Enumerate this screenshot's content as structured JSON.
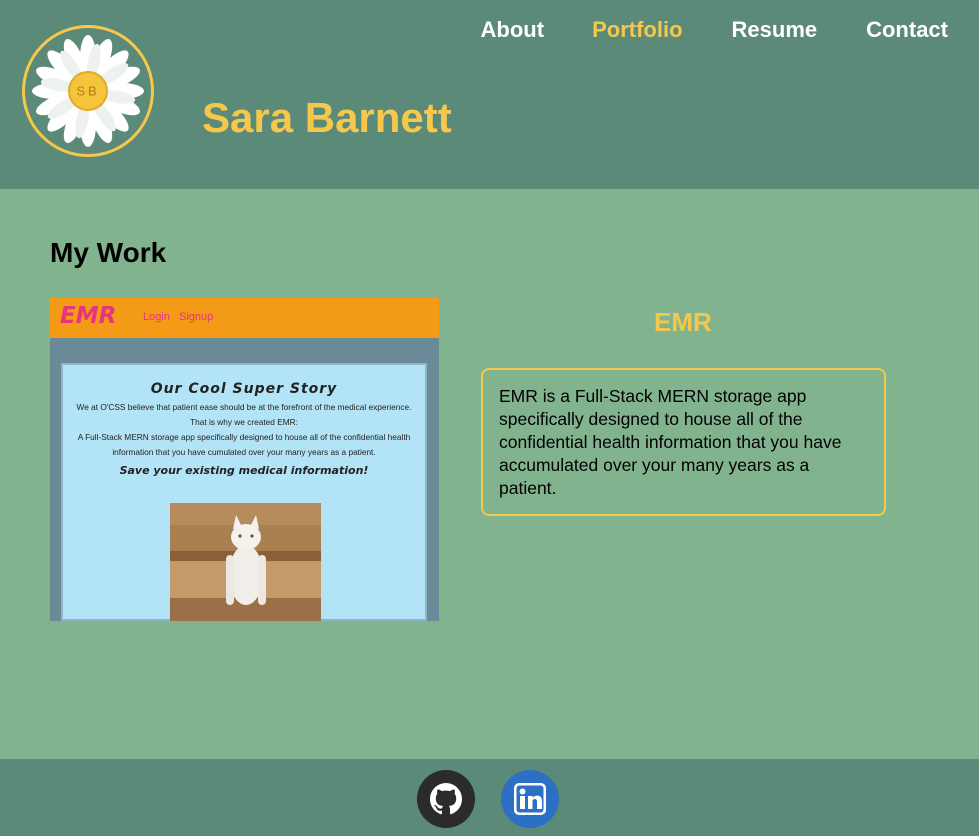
{
  "header": {
    "logo_initials": "SB",
    "site_name": "Sara Barnett",
    "nav": [
      {
        "label": "About",
        "active": false
      },
      {
        "label": "Portfolio",
        "active": true
      },
      {
        "label": "Resume",
        "active": false
      },
      {
        "label": "Contact",
        "active": false
      }
    ]
  },
  "main": {
    "section_title": "My Work",
    "project": {
      "title": "EMR",
      "description": "EMR is a Full-Stack MERN storage app specifically designed to house all of the confidential health information that you have accumulated over your many years as a patient.",
      "screenshot": {
        "logo": "EMR",
        "links": [
          "Login",
          "Signup"
        ],
        "heading": "Our Cool Super Story",
        "paragraphs": [
          "We at O'CSS believe that patient ease should be at the forefront of the medical experience.",
          "That is why we created EMR:",
          "A Full-Stack MERN storage app specifically designed to house all of the confidential health information that you have cumulated over your many years as a patient."
        ],
        "subheading": "Save your existing medical information!"
      }
    }
  },
  "footer": {
    "links": [
      {
        "icon": "github-icon"
      },
      {
        "icon": "linkedin-icon"
      }
    ]
  },
  "colors": {
    "header_bg": "#5c8a78",
    "page_bg": "#82b38f",
    "accent": "#f5c84c",
    "thumb_bar": "#f39a17",
    "thumb_logo": "#e8347e"
  }
}
